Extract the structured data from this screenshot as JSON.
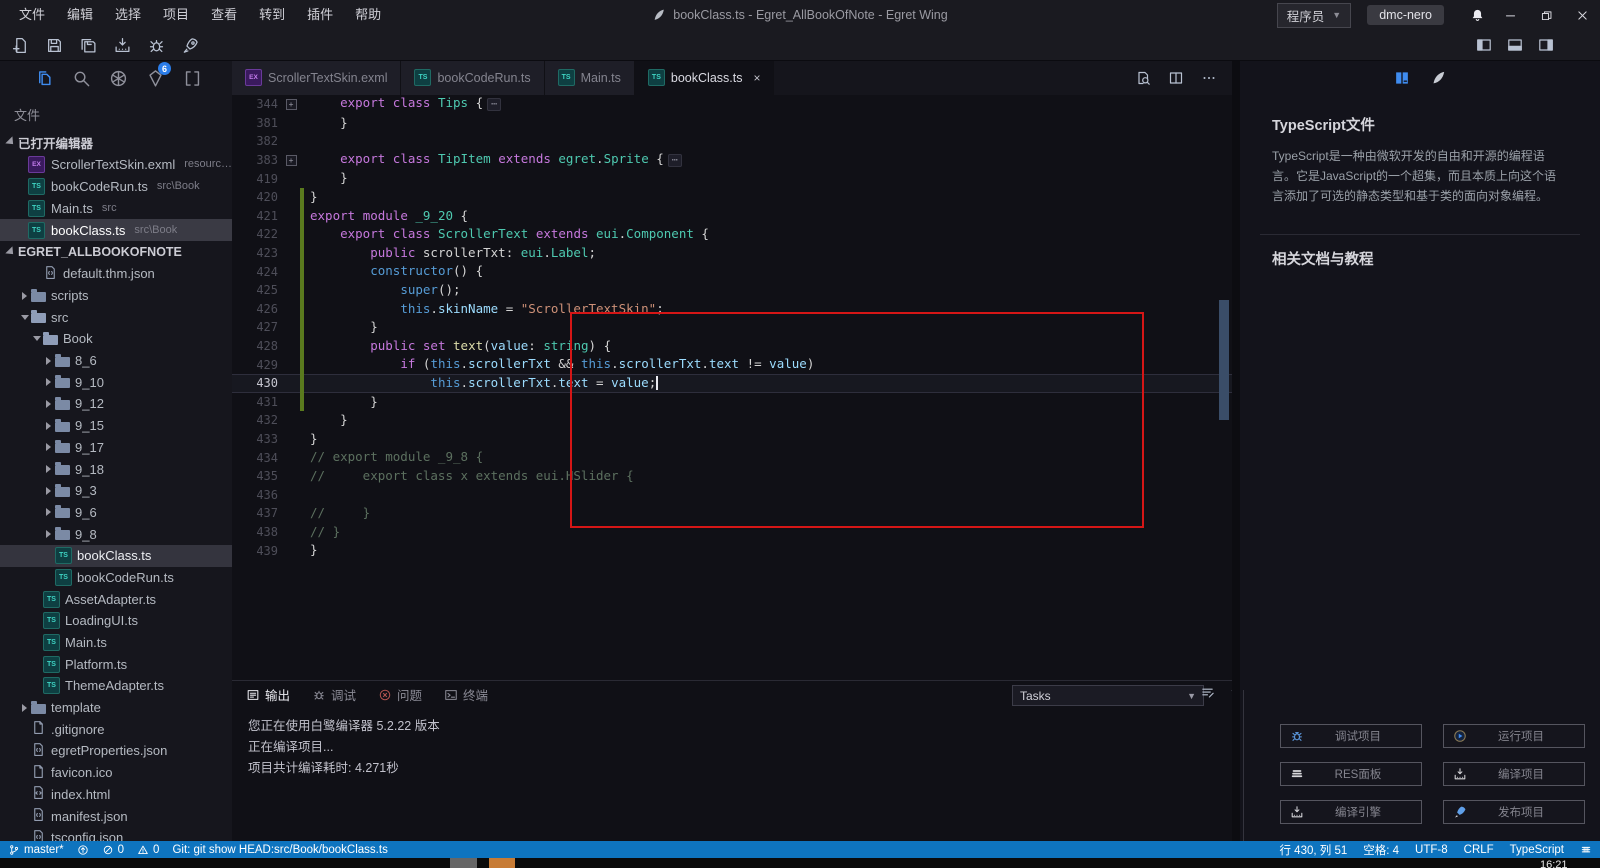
{
  "title_bar": {
    "menus": [
      "文件",
      "编辑",
      "选择",
      "项目",
      "查看",
      "转到",
      "插件",
      "帮助"
    ],
    "app_icon": "egret-feather-icon",
    "title": "bookClass.ts - Egret_AllBookOfNote - Egret Wing",
    "role_button": "程序员",
    "account_button": "dmc-nero",
    "bell_icon": "bell-icon",
    "window_controls": [
      "minimize-icon",
      "restore-icon",
      "close-icon"
    ]
  },
  "toolbar": {
    "left_icons": [
      "new-project-icon",
      "save-icon",
      "save-all-icon",
      "build-icon",
      "debug-bug-icon",
      "publish-rocket-icon"
    ],
    "layout_icons": [
      "layout-sidebar-left-icon",
      "layout-panel-bottom-icon",
      "layout-sidebar-right-icon"
    ]
  },
  "activity_bar": {
    "icons": [
      {
        "name": "files-icon",
        "active": true
      },
      {
        "name": "search-icon"
      },
      {
        "name": "egret-wheel-icon"
      },
      {
        "name": "egret-launcher-icon",
        "badge": "6"
      },
      {
        "name": "extensions-icon"
      }
    ]
  },
  "sidebar": {
    "section_title": "文件",
    "open_editors_header": "已打开编辑器",
    "open_editors": [
      {
        "label": "ScrollerTextSkin.exml",
        "path": "resource...",
        "icon": "exml"
      },
      {
        "label": "bookCodeRun.ts",
        "path": "src\\Book",
        "icon": "ts"
      },
      {
        "label": "Main.ts",
        "path": "src",
        "icon": "ts"
      },
      {
        "label": "bookClass.ts",
        "path": "src\\Book",
        "icon": "ts",
        "selected": true
      }
    ],
    "project_header": "EGRET_ALLBOOKOFNOTE",
    "tree": [
      {
        "label": "default.thm.json",
        "level": 2,
        "icon": "json"
      },
      {
        "label": "scripts",
        "level": 1,
        "icon": "folder",
        "arrow": "right"
      },
      {
        "label": "src",
        "level": 1,
        "icon": "folder-open",
        "arrow": "down"
      },
      {
        "label": "Book",
        "level": 2,
        "icon": "folder-open",
        "arrow": "down"
      },
      {
        "label": "8_6",
        "level": 3,
        "icon": "folder",
        "arrow": "right"
      },
      {
        "label": "9_10",
        "level": 3,
        "icon": "folder",
        "arrow": "right"
      },
      {
        "label": "9_12",
        "level": 3,
        "icon": "folder",
        "arrow": "right"
      },
      {
        "label": "9_15",
        "level": 3,
        "icon": "folder",
        "arrow": "right"
      },
      {
        "label": "9_17",
        "level": 3,
        "icon": "folder",
        "arrow": "right"
      },
      {
        "label": "9_18",
        "level": 3,
        "icon": "folder",
        "arrow": "right"
      },
      {
        "label": "9_3",
        "level": 3,
        "icon": "folder",
        "arrow": "right"
      },
      {
        "label": "9_6",
        "level": 3,
        "icon": "folder",
        "arrow": "right"
      },
      {
        "label": "9_8",
        "level": 3,
        "icon": "folder",
        "arrow": "right"
      },
      {
        "label": "bookClass.ts",
        "level": 3,
        "icon": "ts",
        "selected": true
      },
      {
        "label": "bookCodeRun.ts",
        "level": 3,
        "icon": "ts"
      },
      {
        "label": "AssetAdapter.ts",
        "level": 2,
        "icon": "ts"
      },
      {
        "label": "LoadingUI.ts",
        "level": 2,
        "icon": "ts"
      },
      {
        "label": "Main.ts",
        "level": 2,
        "icon": "ts"
      },
      {
        "label": "Platform.ts",
        "level": 2,
        "icon": "ts"
      },
      {
        "label": "ThemeAdapter.ts",
        "level": 2,
        "icon": "ts"
      },
      {
        "label": "template",
        "level": 1,
        "icon": "folder",
        "arrow": "right"
      },
      {
        "label": ".gitignore",
        "level": 1,
        "icon": "file"
      },
      {
        "label": "egretProperties.json",
        "level": 1,
        "icon": "json"
      },
      {
        "label": "favicon.ico",
        "level": 1,
        "icon": "file"
      },
      {
        "label": "index.html",
        "level": 1,
        "icon": "html"
      },
      {
        "label": "manifest.json",
        "level": 1,
        "icon": "json"
      },
      {
        "label": "tsconfig.json",
        "level": 1,
        "icon": "json"
      }
    ]
  },
  "editor": {
    "tabs": [
      {
        "label": "ScrollerTextSkin.exml",
        "icon": "exml"
      },
      {
        "label": "bookCodeRun.ts",
        "icon": "ts"
      },
      {
        "label": "Main.ts",
        "icon": "ts"
      },
      {
        "label": "bookClass.ts",
        "icon": "ts",
        "active": true,
        "close": "×"
      }
    ],
    "actions": [
      "open-preview-icon",
      "split-editor-icon",
      "more-actions-icon"
    ],
    "annotation": {
      "type": "red-box",
      "color": "#d51616"
    },
    "lines": [
      {
        "n": 344,
        "i": 1,
        "fold": true,
        "t": [
          [
            "k",
            "export"
          ],
          [
            "p",
            " "
          ],
          [
            "k",
            "class"
          ],
          [
            "p",
            " "
          ],
          [
            "t",
            "Tips"
          ],
          [
            "p",
            " {"
          ],
          [
            "d",
            "⋯"
          ]
        ]
      },
      {
        "n": 381,
        "i": 1,
        "t": [
          [
            "p",
            "}"
          ]
        ]
      },
      {
        "n": 382,
        "i": 0,
        "t": []
      },
      {
        "n": 383,
        "i": 1,
        "fold": true,
        "t": [
          [
            "k",
            "export"
          ],
          [
            "p",
            " "
          ],
          [
            "k",
            "class"
          ],
          [
            "p",
            " "
          ],
          [
            "t",
            "TipItem"
          ],
          [
            "p",
            " "
          ],
          [
            "k",
            "extends"
          ],
          [
            "p",
            " "
          ],
          [
            "t",
            "egret"
          ],
          [
            "p",
            "."
          ],
          [
            "t",
            "Sprite"
          ],
          [
            "p",
            " {"
          ],
          [
            "d",
            "⋯"
          ]
        ]
      },
      {
        "n": 419,
        "i": 1,
        "t": [
          [
            "p",
            "}"
          ]
        ]
      },
      {
        "n": 420,
        "i": 0,
        "chg": true,
        "t": [
          [
            "p",
            "}"
          ]
        ]
      },
      {
        "n": 421,
        "i": 0,
        "chg": true,
        "t": [
          [
            "k",
            "export"
          ],
          [
            "p",
            " "
          ],
          [
            "k",
            "module"
          ],
          [
            "p",
            " "
          ],
          [
            "t",
            "_9_20"
          ],
          [
            "p",
            " {"
          ]
        ]
      },
      {
        "n": 422,
        "i": 1,
        "chg": true,
        "t": [
          [
            "k",
            "export"
          ],
          [
            "p",
            " "
          ],
          [
            "k",
            "class"
          ],
          [
            "p",
            " "
          ],
          [
            "t",
            "ScrollerText"
          ],
          [
            "p",
            " "
          ],
          [
            "k",
            "extends"
          ],
          [
            "p",
            " "
          ],
          [
            "t",
            "eui"
          ],
          [
            "p",
            "."
          ],
          [
            "t",
            "Component"
          ],
          [
            "p",
            " {"
          ]
        ]
      },
      {
        "n": 423,
        "i": 2,
        "chg": true,
        "t": [
          [
            "k",
            "public"
          ],
          [
            "p",
            " scrollerTxt"
          ],
          [
            "p",
            ": "
          ],
          [
            "t",
            "eui"
          ],
          [
            "p",
            "."
          ],
          [
            "t",
            "Label"
          ],
          [
            "p",
            ";"
          ]
        ]
      },
      {
        "n": 424,
        "i": 2,
        "chg": true,
        "t": [
          [
            "b",
            "constructor"
          ],
          [
            "p",
            "() {"
          ]
        ]
      },
      {
        "n": 425,
        "i": 3,
        "chg": true,
        "t": [
          [
            "b",
            "super"
          ],
          [
            "p",
            "();"
          ]
        ]
      },
      {
        "n": 426,
        "i": 3,
        "chg": true,
        "t": [
          [
            "b",
            "this"
          ],
          [
            "p",
            "."
          ],
          [
            "v",
            "skinName"
          ],
          [
            "p",
            " = "
          ],
          [
            "s",
            "\"ScrollerTextSkin\""
          ],
          [
            "p",
            ";"
          ]
        ]
      },
      {
        "n": 427,
        "i": 2,
        "chg": true,
        "t": [
          [
            "p",
            "}"
          ]
        ]
      },
      {
        "n": 428,
        "i": 2,
        "chg": true,
        "t": [
          [
            "k",
            "public"
          ],
          [
            "p",
            " "
          ],
          [
            "k",
            "set"
          ],
          [
            "p",
            " "
          ],
          [
            "f",
            "text"
          ],
          [
            "p",
            "("
          ],
          [
            "v",
            "value"
          ],
          [
            "p",
            ": "
          ],
          [
            "t",
            "string"
          ],
          [
            "p",
            ") {"
          ]
        ]
      },
      {
        "n": 429,
        "i": 3,
        "chg": true,
        "t": [
          [
            "k",
            "if"
          ],
          [
            "p",
            " ("
          ],
          [
            "b",
            "this"
          ],
          [
            "p",
            "."
          ],
          [
            "v",
            "scrollerTxt"
          ],
          [
            "p",
            " && "
          ],
          [
            "b",
            "this"
          ],
          [
            "p",
            "."
          ],
          [
            "v",
            "scrollerTxt"
          ],
          [
            "p",
            "."
          ],
          [
            "v",
            "text"
          ],
          [
            "p",
            " != "
          ],
          [
            "v",
            "value"
          ],
          [
            "p",
            ")"
          ]
        ]
      },
      {
        "n": 430,
        "i": 4,
        "chg": true,
        "cur": true,
        "t": [
          [
            "b",
            "this"
          ],
          [
            "p",
            "."
          ],
          [
            "v",
            "scrollerTxt"
          ],
          [
            "p",
            "."
          ],
          [
            "v",
            "text"
          ],
          [
            "p",
            " = "
          ],
          [
            "v",
            "value"
          ],
          [
            "p",
            ";"
          ]
        ]
      },
      {
        "n": 431,
        "i": 2,
        "chg": true,
        "t": [
          [
            "p",
            "}"
          ]
        ]
      },
      {
        "n": 432,
        "i": 1,
        "t": [
          [
            "p",
            "}"
          ]
        ]
      },
      {
        "n": 433,
        "i": 0,
        "t": [
          [
            "p",
            "}"
          ]
        ]
      },
      {
        "n": 434,
        "i": 0,
        "t": [
          [
            "c",
            "// export module _9_8 {"
          ]
        ]
      },
      {
        "n": 435,
        "i": 0,
        "t": [
          [
            "c",
            "//     export class x extends eui.HSlider {"
          ]
        ]
      },
      {
        "n": 436,
        "i": 0,
        "t": []
      },
      {
        "n": 437,
        "i": 0,
        "t": [
          [
            "c",
            "//     }"
          ]
        ]
      },
      {
        "n": 438,
        "i": 0,
        "t": [
          [
            "c",
            "// }"
          ]
        ]
      },
      {
        "n": 439,
        "i": 0,
        "t": [
          [
            "p",
            "}"
          ]
        ]
      }
    ]
  },
  "panel": {
    "tabs": [
      {
        "label": "输出",
        "icon": "output-icon",
        "active": true
      },
      {
        "label": "调试",
        "icon": "debug-console-icon"
      },
      {
        "label": "问题",
        "icon": "problems-icon",
        "problems": true
      },
      {
        "label": "终端",
        "icon": "terminal-icon"
      }
    ],
    "tasks_label": "Tasks",
    "actions": [
      "filter-icon",
      "chevron-down-icon"
    ],
    "output_lines": [
      "您正在使用白鹭编译器 5.2.22 版本",
      "正在编译项目...",
      "项目共计编译耗时: 4.271秒"
    ]
  },
  "right_panel": {
    "header_icons": [
      {
        "name": "book-icon",
        "active": true
      },
      {
        "name": "wing-icon"
      }
    ],
    "doc_title": "TypeScript文件",
    "doc_body": "TypeScript是一种由微软开发的自由和开源的编程语言。它是JavaScript的一个超集，而且本质上向这个语言添加了可选的静态类型和基于类的面向对象编程。",
    "section2_title": "相关文档与教程",
    "buttons": [
      {
        "icon": "bug-icon",
        "label": "调试项目",
        "blue": true
      },
      {
        "icon": "play-icon",
        "label": "运行项目",
        "blue": true
      },
      {
        "icon": "res-stack-icon",
        "label": "RES面板"
      },
      {
        "icon": "compile-icon",
        "label": "编译项目"
      },
      {
        "icon": "engine-compile-icon",
        "label": "编译引擎"
      },
      {
        "icon": "publish-rocket2-icon",
        "label": "发布项目",
        "blue": true
      }
    ]
  },
  "status_bar": {
    "left": [
      {
        "icon": "git-branch-icon",
        "label": "master*"
      },
      {
        "icon": "sync-icon",
        "label": ""
      },
      {
        "icon": "error-icon",
        "label": "0"
      },
      {
        "icon": "warning-icon",
        "label": "0"
      },
      {
        "icon": "",
        "label": "Git: git show HEAD:src/Book/bookClass.ts"
      }
    ],
    "right": [
      {
        "icon": "",
        "label": "行 430, 列 51"
      },
      {
        "icon": "",
        "label": "空格: 4"
      },
      {
        "icon": "",
        "label": "UTF-8"
      },
      {
        "icon": "",
        "label": "CRLF"
      },
      {
        "icon": "",
        "label": "TypeScript"
      },
      {
        "icon": "grid-icon",
        "label": ""
      }
    ]
  },
  "taskbar": {
    "clock": "16:21"
  },
  "colors": {
    "accent_blue": "#3f8cf0",
    "status_bar": "#0e74bf",
    "annotation_red": "#d51616",
    "modified_gutter_green": "#5a7a1e"
  }
}
